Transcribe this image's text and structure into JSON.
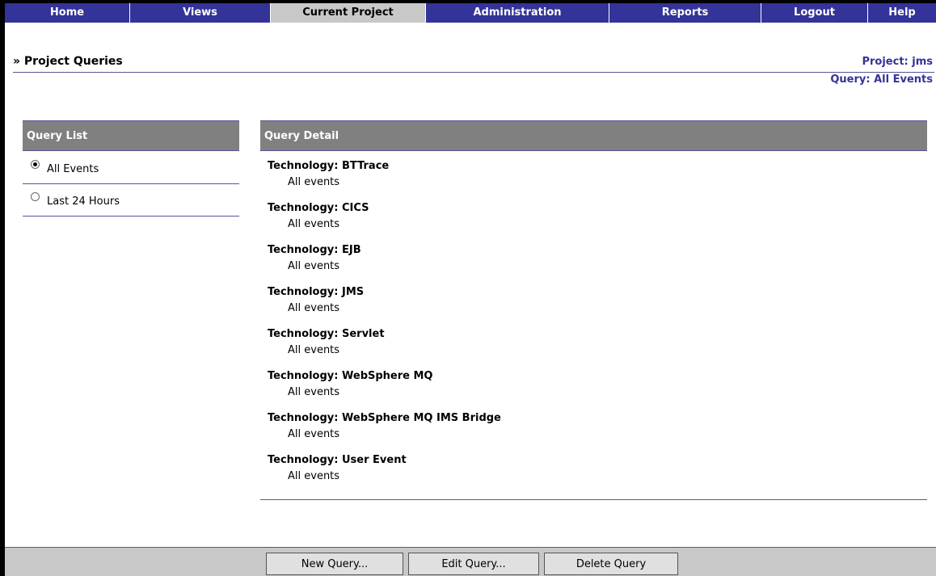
{
  "nav": {
    "items": [
      {
        "label": "Home"
      },
      {
        "label": "Views"
      },
      {
        "label": "Current Project"
      },
      {
        "label": "Administration"
      },
      {
        "label": "Reports"
      },
      {
        "label": "Logout"
      },
      {
        "label": "Help"
      }
    ],
    "active": "Current Project"
  },
  "header": {
    "title": "» Project Queries",
    "project": "Project: jms",
    "query": "Query: All Events"
  },
  "query_list": {
    "title": "Query List",
    "items": [
      {
        "label": "All Events",
        "checked": true
      },
      {
        "label": "Last 24 Hours",
        "checked": false
      }
    ]
  },
  "query_detail": {
    "title": "Query Detail",
    "technologies": [
      {
        "name": "Technology: BTTrace",
        "value": "All events"
      },
      {
        "name": "Technology: CICS",
        "value": "All events"
      },
      {
        "name": "Technology: EJB",
        "value": "All events"
      },
      {
        "name": "Technology: JMS",
        "value": "All events"
      },
      {
        "name": "Technology: Servlet",
        "value": "All events"
      },
      {
        "name": "Technology: WebSphere MQ",
        "value": "All events"
      },
      {
        "name": "Technology: WebSphere MQ IMS Bridge",
        "value": "All events"
      },
      {
        "name": "Technology: User Event",
        "value": "All events"
      }
    ]
  },
  "footer": {
    "new_label": "New Query...",
    "edit_label": "Edit Query...",
    "delete_label": "Delete Query"
  }
}
